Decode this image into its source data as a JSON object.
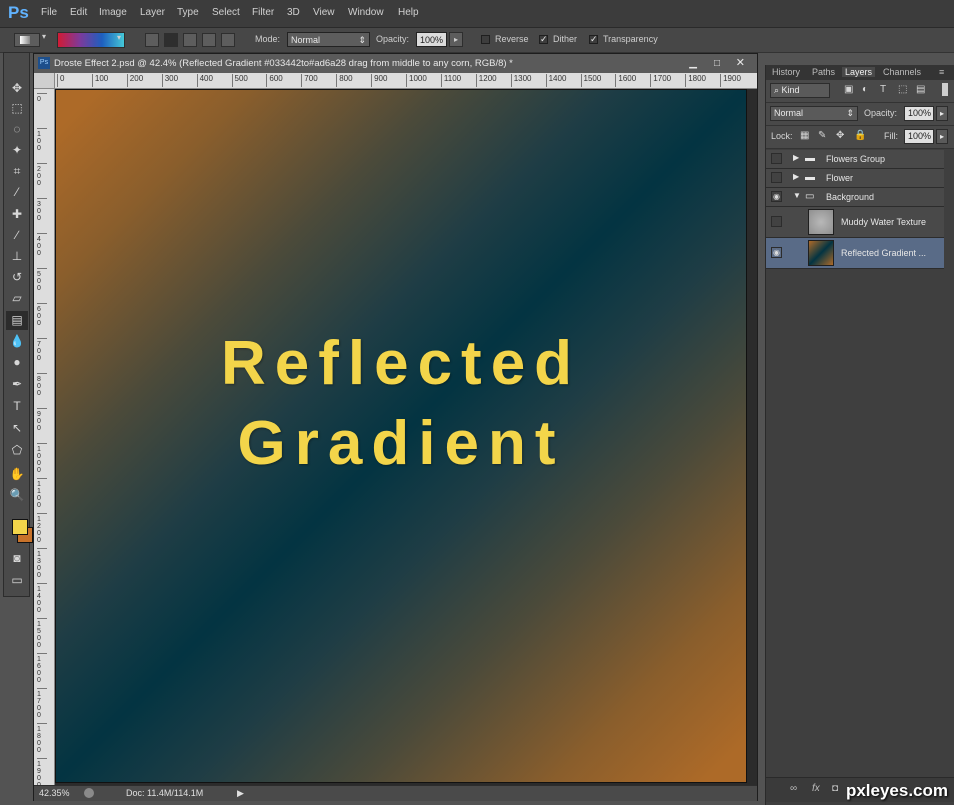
{
  "app": {
    "logo": "Ps"
  },
  "menu": [
    "File",
    "Edit",
    "Image",
    "Layer",
    "Type",
    "Select",
    "Filter",
    "3D",
    "View",
    "Window",
    "Help"
  ],
  "options_bar": {
    "mode_label": "Mode:",
    "mode_value": "Normal",
    "opacity_label": "Opacity:",
    "opacity_value": "100%",
    "reverse_label": "Reverse",
    "dither_label": "Dither",
    "transparency_label": "Transparency",
    "reverse_checked": false,
    "dither_checked": true,
    "transparency_checked": true
  },
  "document": {
    "title": "Droste Effect 2.psd @ 42.4% (Reflected Gradient #033442to#ad6a28 drag from middle to any corn, RGB/8) *",
    "ruler_top": [
      "0",
      "100",
      "200",
      "300",
      "400",
      "500",
      "600",
      "700",
      "800",
      "900",
      "1000",
      "1100",
      "1200",
      "1300",
      "1400",
      "1500",
      "1600",
      "1700",
      "1800",
      "1900"
    ],
    "ruler_left": [
      "0",
      "1 0 0",
      "2 0 0",
      "3 0 0",
      "4 0 0",
      "5 0 0",
      "6 0 0",
      "7 0 0",
      "8 0 0",
      "9 0 0",
      "1 0 0 0",
      "1 1 0 0",
      "1 2 0 0",
      "1 3 0 0",
      "1 4 0 0",
      "1 5 0 0",
      "1 6 0 0",
      "1 7 0 0",
      "1 8 0 0",
      "1 9 0 0"
    ],
    "canvas_text_line1": "Reflected",
    "canvas_text_line2": "Gradient",
    "gradient_colors": [
      "#033442",
      "#ad6a28"
    ],
    "status_zoom": "42.35%",
    "status_doc": "Doc: 11.4M/114.1M"
  },
  "panel": {
    "tabs": [
      "History",
      "Paths",
      "Layers",
      "Channels"
    ],
    "active_tab": "Layers",
    "filter_kind": "Kind",
    "blend_mode": "Normal",
    "opacity_label": "Opacity:",
    "opacity_value": "100%",
    "lock_label": "Lock:",
    "fill_label": "Fill:",
    "fill_value": "100%",
    "layers": [
      {
        "name": "Flowers Group",
        "type": "group",
        "visible": false,
        "expanded": false
      },
      {
        "name": "Flower",
        "type": "group",
        "visible": false,
        "expanded": false
      },
      {
        "name": "Background",
        "type": "group",
        "visible": true,
        "expanded": true
      },
      {
        "name": "Muddy Water Texture",
        "type": "layer",
        "visible": false,
        "selected": false
      },
      {
        "name": "Reflected Gradient ...",
        "type": "layer",
        "visible": true,
        "selected": true
      }
    ]
  },
  "colors": {
    "foreground": "#f3d54a",
    "background": "#c8722a",
    "accent": "#61b3ff"
  },
  "watermark": "pxleyes.com"
}
